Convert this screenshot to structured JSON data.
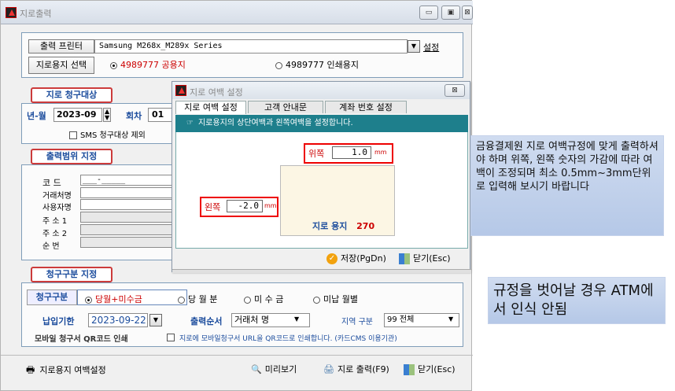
{
  "window": {
    "title": "지로출력",
    "min": "▭",
    "max": "▣",
    "close": "⊠"
  },
  "printer": {
    "label": "출력 프린터",
    "value": "Samsung M268x_M289x Series",
    "setup_button": "설정"
  },
  "paper_select": {
    "label": "지로용지 선택",
    "options": [
      "4989777 공용지",
      "4989777 인쇄용지"
    ],
    "selected": 0
  },
  "billing_target": {
    "group_label": "지로 청구대상",
    "year_month_label": "년-월",
    "year_month_value": "2023-09",
    "round_label": "회차",
    "round_value": "01",
    "sms_exclude_label": "SMS 청구대상 제외"
  },
  "output_range": {
    "group_label": "출력범위 지정",
    "fields": [
      {
        "label": "코   드",
        "value": "___-_____"
      },
      {
        "label": "거래처명",
        "value": ""
      },
      {
        "label": "사용자명",
        "value": ""
      },
      {
        "label": "주 소 1",
        "value": ""
      },
      {
        "label": "주 소 2",
        "value": ""
      },
      {
        "label": "순   번",
        "value": ""
      }
    ]
  },
  "billing_type": {
    "group_label": "청구구분 지정",
    "type_label": "청구구분",
    "options": [
      "당월+미수금",
      "당 월 분",
      "미 수 금",
      "미납 월별"
    ],
    "selected": 0,
    "due_label": "납입기한",
    "due_value": "2023-09-22",
    "order_label": "출력순서",
    "order_value": "거래처 명",
    "region_label": "지역 구분",
    "region_value": "99 전체",
    "mobile_label": "모바일 청구서 QR코드 인쇄",
    "mobile_desc": "지로에 모바일청구서 URL을 QR코드로 인쇄합니다. (카드CMS 이용기관)"
  },
  "bottom_bar": {
    "margin_setting": "지로용지 여백설정",
    "preview": "미리보기",
    "print": "지로 출력(F9)",
    "close": "닫기(Esc)"
  },
  "dialog": {
    "title": "지로 여백 설정",
    "close": "⊠",
    "tabs": [
      "지로 여백 설정",
      "고객 안내문",
      "계좌 번호 설정"
    ],
    "active_tab": 0,
    "info": "지로용지의 상단여백과 왼쪽여백을 설정합니다.",
    "top_label": "위쪽",
    "top_value": "1.0",
    "left_label": "왼쪽",
    "left_value": "-2.0",
    "unit": "mm",
    "paper_label": "지로 용지",
    "paper_code": "270",
    "save_button": "저장(PgDn)",
    "close_button": "닫기(Esc)"
  },
  "notes": {
    "note1": "금융결제원 지로 여백규정에 맞게 출력하셔야 하며 위쪽, 왼쪽 숫자의 가감에 따라 여백이 조정되며 최소 0.5mm~3mm단위로 입력해 보시기 바랍니다",
    "note2": "규정을 벗어날 경우 ATM에서 인식 안됨"
  },
  "colors": {
    "accent_red": "#cc3b3b",
    "label_blue": "#1a4b9c",
    "teal": "#1e7f8c",
    "note_bg": "#c3d3ec"
  }
}
